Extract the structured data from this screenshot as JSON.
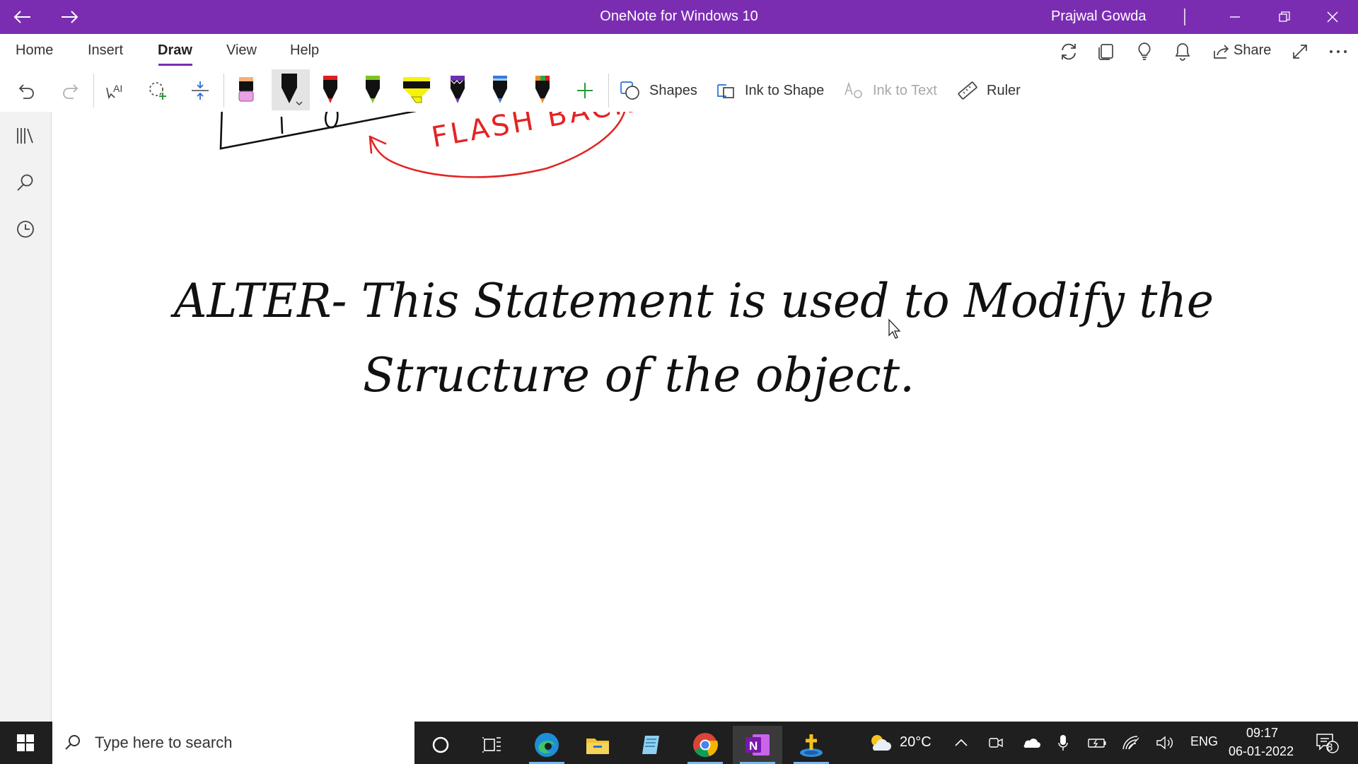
{
  "window": {
    "title": "OneNote for Windows 10",
    "user": "Prajwal Gowda",
    "accent": "#7b2db2"
  },
  "ribbon": {
    "tabs": [
      "Home",
      "Insert",
      "Draw",
      "View",
      "Help"
    ],
    "active_tab": "Draw",
    "share_label": "Share"
  },
  "toolbar": {
    "pens": [
      {
        "name": "highlighter-pink",
        "color": "#e9a2e6"
      },
      {
        "name": "pen-black",
        "color": "#111111",
        "selected": true
      },
      {
        "name": "pen-red",
        "color": "#e01e1e"
      },
      {
        "name": "pen-green",
        "color": "#7fc41f"
      },
      {
        "name": "highlighter-yellow",
        "color": "#f4f20e"
      },
      {
        "name": "pen-purple-galaxy",
        "color": "#6b2fb0"
      },
      {
        "name": "pen-blue-galaxy",
        "color": "#3a79d6"
      },
      {
        "name": "pen-rainbow",
        "color": "#f28a1e"
      }
    ],
    "shapes_label": "Shapes",
    "ink_to_shape_label": "Ink to Shape",
    "ink_to_text_label": "Ink to Text",
    "ruler_label": "Ruler"
  },
  "sidebar": {
    "icons": [
      "notebooks-icon",
      "search-icon",
      "recent-icon"
    ]
  },
  "page": {
    "ink_fragment_label": "FLASH BACK",
    "ink_line1": "ALTER- This Statement is used to Modify the",
    "ink_line2": "Structure of the object."
  },
  "taskbar": {
    "search_placeholder": "Type here to search",
    "weather_temp": "20°C",
    "language": "ENG",
    "time": "09:17",
    "date": "06-01-2022",
    "notification_count": "8"
  }
}
